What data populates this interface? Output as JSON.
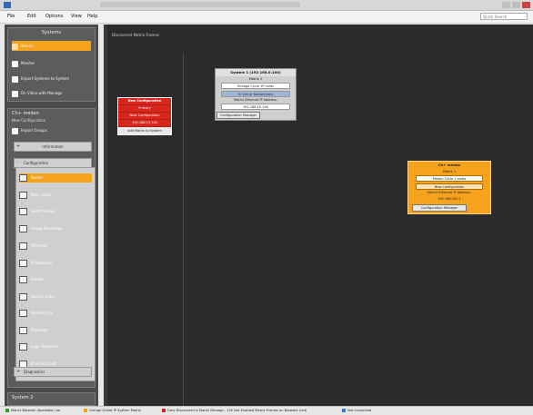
{
  "window": {
    "title": "",
    "menu": [
      "File",
      "Edit",
      "Options",
      "View",
      "Help"
    ],
    "search_placeholder": "Quick Search"
  },
  "sidebar": {
    "systems_panel": {
      "title": "Systems",
      "items": [
        {
          "label": "Search",
          "icon": "search-icon",
          "active": true
        },
        {
          "label": "Monitor",
          "icon": "monitor-icon",
          "active": false
        },
        {
          "label": "Import Systems to System",
          "icon": "import-icon",
          "active": false
        },
        {
          "label": "On Video with Manage",
          "icon": "video-icon",
          "active": false
        }
      ]
    },
    "system_panel": {
      "title": "Ch+ medan",
      "subtitle": "New Configuration",
      "item": "Import Groups",
      "sections": {
        "information": "Information",
        "configuration": "Configuration",
        "diagnostics": "Diagnostics"
      },
      "config_items": [
        {
          "label": "Router",
          "active": true
        },
        {
          "label": "Port / Links",
          "active": false
        },
        {
          "label": "Switch Group",
          "active": false
        },
        {
          "label": "Group Alternates",
          "active": false
        },
        {
          "label": "Ethernet",
          "active": false
        },
        {
          "label": "IP Multicast",
          "active": false
        },
        {
          "label": "Routes",
          "active": false
        },
        {
          "label": "Source Links",
          "active": false
        },
        {
          "label": "Access Lists",
          "active": false
        },
        {
          "label": "Protocols",
          "active": false
        },
        {
          "label": "Logic Switches",
          "active": false
        },
        {
          "label": "IP Assets Lists",
          "active": false
        }
      ]
    },
    "bottom_panel": {
      "title": "System 2"
    }
  },
  "canvas": {
    "header": "Discovered Matrix Frames",
    "red_card": {
      "title": "New Configuration",
      "rows": [
        "Primary",
        "Next Configuration",
        "192.168.10.100"
      ],
      "button": "Add Matrix to System"
    },
    "gray_card": {
      "title": "System 1 (192.168.0.100)",
      "matrix_label": "Matrix 1",
      "matrix_value": "Vintage Cycle 1P cards",
      "link": "IC Cell or Ranked Jons",
      "ip_label": "Matrix Ethernet IP Address:",
      "ip_value": "192.168.10.100",
      "button": "Configuration Manager"
    },
    "orange_card": {
      "title": "Ch+ medan",
      "matrix_label": "Matrix 1",
      "matrix_value": "Medan Cycle 1 cards",
      "config": "New Configuration",
      "ip_label": "Matrix Ethernet IP Address:",
      "ip_value": "192.168.100.1",
      "button": "Configuration Manager"
    }
  },
  "statusbar": {
    "items": [
      {
        "label": "Matrix Network (Available) via",
        "color": "#2aa62a"
      },
      {
        "label": "Orange Outlet IP System Matrix",
        "color": "#f5a21c"
      },
      {
        "label": "Grey Discovered is Matrix Manage - 192 Not Enabled Matrix Frames on Network (red)",
        "color": "#d9261d"
      },
      {
        "label": "Not connected",
        "color": "#3d77c7"
      }
    ]
  },
  "colors": {
    "accent": "#f5a21c",
    "error": "#d9261d",
    "canvas": "#2b2b2d",
    "sidebar": "#4a4a4a"
  }
}
